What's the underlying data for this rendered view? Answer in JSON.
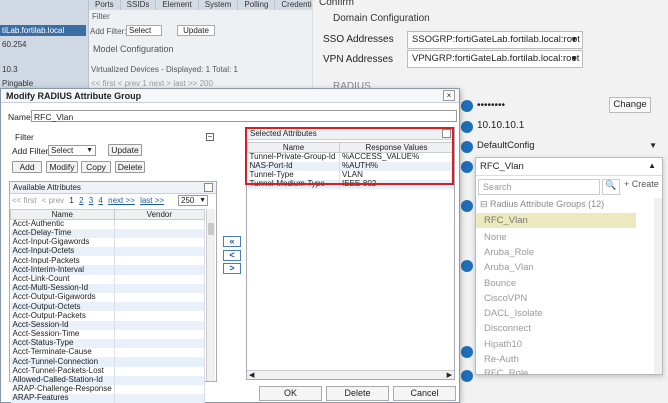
{
  "background": {
    "tree": {
      "host_suffix": "tiLab.fortilab.local",
      "ip_suffix": "60.254",
      "ip2_suffix": "10.3",
      "pingable": "Pingable"
    },
    "tabs": [
      "Ports",
      "SSIDs",
      "Element",
      "System",
      "Polling",
      "Credentials"
    ],
    "filter_label": "Filter",
    "add_filter_label": "Add Filter:",
    "add_filter_value": "Select",
    "update_label": "Update",
    "model_configuration": "Model Configuration",
    "virtualized_devices": "Virtualized Devices - Displayed: 1  Total: 1",
    "pager": {
      "first": "<< first",
      "prev": "< prev",
      "page": "1",
      "next": "next >",
      "last": "last >>",
      "per_page": "200"
    }
  },
  "right_panel": {
    "confirm": "Confirm",
    "domain_configuration": "Domain Configuration",
    "sso_label": "SSO Addresses",
    "sso_value": "SSOGRP:fortiGateLab.fortilab.local:root",
    "vpn_label": "VPN Addresses",
    "vpn_value": "VPNGRP:fortiGateLab.fortilab.local:root",
    "radius_label": "RADIUS",
    "secret_value": "••••••••",
    "change_label": "Change",
    "ip_value": "10.10.10.1",
    "config_value": "DefaultConfig",
    "selected_group": "RFC_Vlan",
    "search_placeholder": "Search",
    "create_label": "+ Create",
    "group_header": "Radius Attribute Groups (12)",
    "group_items": [
      "RFC_Vlan",
      "None",
      "Aruba_Role",
      "Aruba_Vlan",
      "Bounce",
      "CiscoVPN",
      "DACL_Isolate",
      "Disconnect",
      "Hipath10",
      "Re-Auth",
      "RFC_Role"
    ]
  },
  "modal": {
    "title": "Modify RADIUS Attribute Group",
    "close": "×",
    "name_label": "Name:",
    "name_value": "RFC_Vlan",
    "filter_label": "Filter",
    "add_filter_label": "Add Filter:",
    "add_filter_value": "Select",
    "update_label": "Update",
    "add_label": "Add",
    "modify_label": "Modify",
    "copy_label": "Copy",
    "delete_label": "Delete",
    "available_title": "Available Attributes",
    "pager": {
      "first": "<< first",
      "prev": "< prev",
      "pages": [
        "1",
        "2",
        "3",
        "4"
      ],
      "next": "next >>",
      "last": "last >>",
      "per_page": "250"
    },
    "available_columns": [
      "Name",
      "Vendor"
    ],
    "available_rows": [
      "Acct-Authentic",
      "Acct-Delay-Time",
      "Acct-Input-Gigawords",
      "Acct-Input-Octets",
      "Acct-Input-Packets",
      "Acct-Interim-Interval",
      "Acct-Link-Count",
      "Acct-Multi-Session-Id",
      "Acct-Output-Gigawords",
      "Acct-Output-Octets",
      "Acct-Output-Packets",
      "Acct-Session-Id",
      "Acct-Session-Time",
      "Acct-Status-Type",
      "Acct-Terminate-Cause",
      "Acct-Tunnel-Connection",
      "Acct-Tunnel-Packets-Lost",
      "Allowed-Called-Station-Id",
      "ARAP-Challenge-Response",
      "ARAP-Features"
    ],
    "arrows": [
      "«",
      "<",
      ">"
    ],
    "selected_title": "Selected Attributes",
    "selected_columns": [
      "Name",
      "Response Values"
    ],
    "selected_rows": [
      {
        "name": "Tunnel-Private-Group-Id",
        "value": "%ACCESS_VALUE%"
      },
      {
        "name": "NAS-Port-Id",
        "value": "%AUTH%"
      },
      {
        "name": "Tunnel-Type",
        "value": "VLAN"
      },
      {
        "name": "Tunnel-Medium-Type",
        "value": "IEEE-802"
      }
    ],
    "ok_label": "OK",
    "delete_button_label": "Delete",
    "cancel_label": "Cancel"
  },
  "colors": {
    "highlight": "#d62020",
    "link": "#1a5aa8",
    "badge": "#1f6fb8",
    "selected_group_bg": "#ece9bf"
  }
}
